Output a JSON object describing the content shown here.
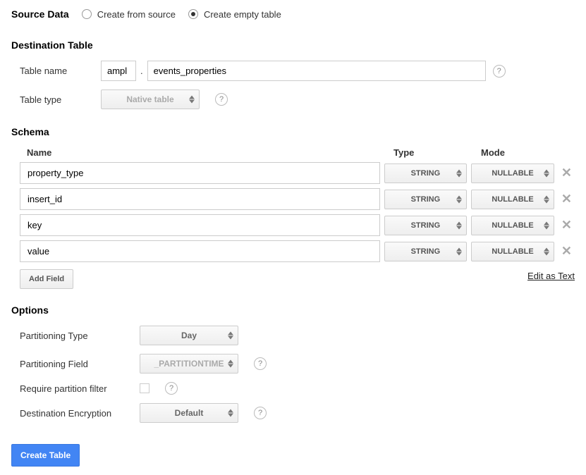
{
  "source_data": {
    "title": "Source Data",
    "option_from_source": "Create from source",
    "option_empty": "Create empty table",
    "selected": "empty"
  },
  "destination": {
    "title": "Destination Table",
    "table_name_label": "Table name",
    "table_name_prefix": "ampl",
    "table_name_value": "events_properties",
    "table_type_label": "Table type",
    "table_type_value": "Native table"
  },
  "schema": {
    "title": "Schema",
    "col_name": "Name",
    "col_type": "Type",
    "col_mode": "Mode",
    "rows": [
      {
        "name": "property_type",
        "type": "STRING",
        "mode": "NULLABLE"
      },
      {
        "name": "insert_id",
        "type": "STRING",
        "mode": "NULLABLE"
      },
      {
        "name": "key",
        "type": "STRING",
        "mode": "NULLABLE"
      },
      {
        "name": "value",
        "type": "STRING",
        "mode": "NULLABLE"
      }
    ],
    "add_field_label": "Add Field",
    "edit_as_text_label": "Edit as Text"
  },
  "options": {
    "title": "Options",
    "partitioning_type_label": "Partitioning Type",
    "partitioning_type_value": "Day",
    "partitioning_field_label": "Partitioning Field",
    "partitioning_field_value": "_PARTITIONTIME",
    "require_filter_label": "Require partition filter",
    "encryption_label": "Destination Encryption",
    "encryption_value": "Default"
  },
  "create_button": "Create Table",
  "help_glyph": "?"
}
